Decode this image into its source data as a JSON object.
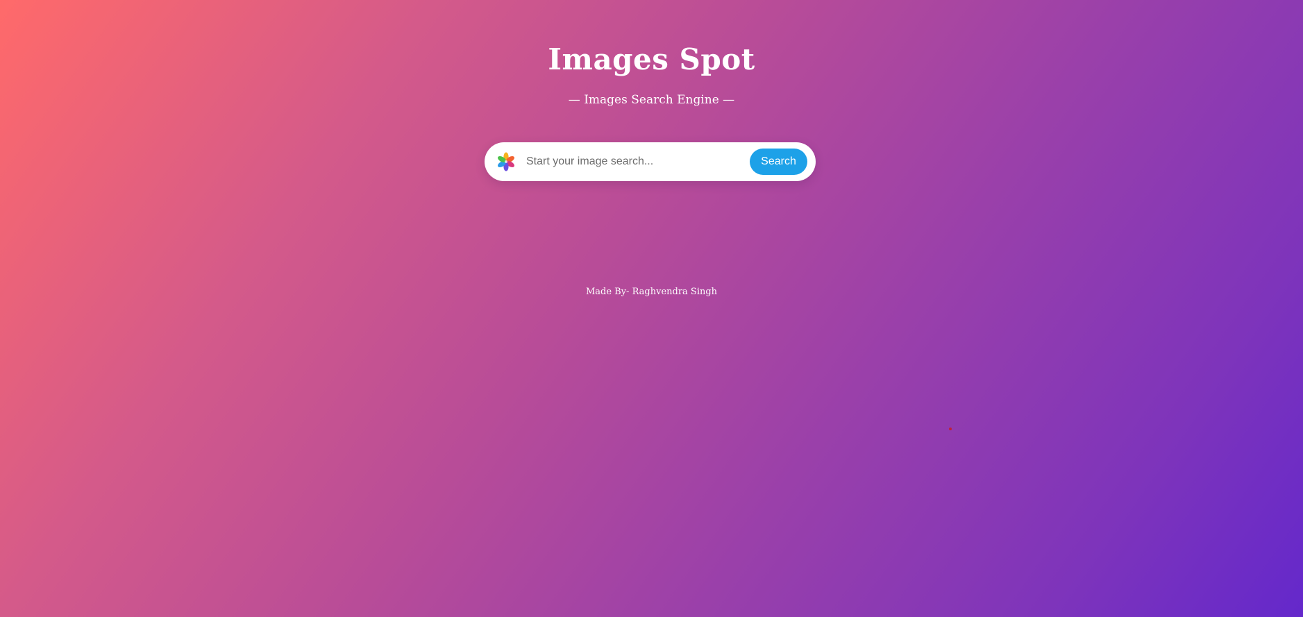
{
  "header": {
    "title": "Images Spot",
    "subtitle": "— Images Search Engine —"
  },
  "search": {
    "icon": "photos-flower-icon",
    "placeholder": "Start your image search...",
    "value": "",
    "button_label": "Search",
    "button_color": "#1da1e8"
  },
  "footer": {
    "credit": "Made By- Raghvendra Singh"
  },
  "colors": {
    "background_start": "#ff6a6a",
    "background_end": "#6428cb",
    "text": "#ffffff"
  }
}
